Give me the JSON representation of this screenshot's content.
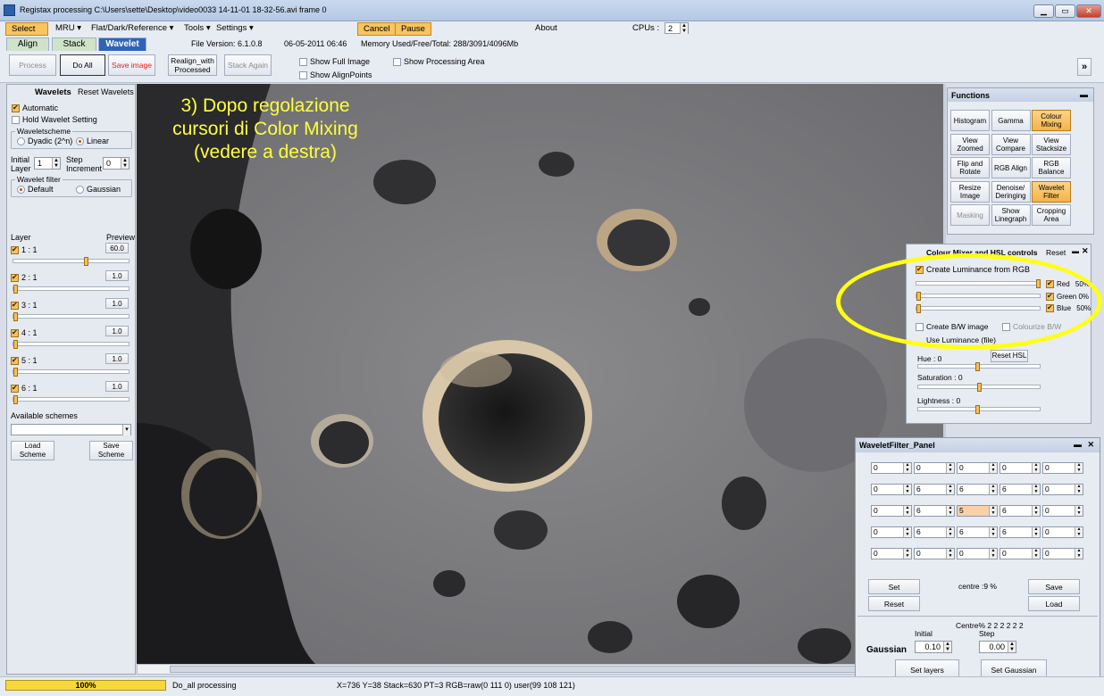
{
  "window": {
    "title": "Registax processing C:\\Users\\sette\\Desktop\\video0033 14-11-01 18-32-56.avi frame 0",
    "min": "▁",
    "max": "▭",
    "close": "✕"
  },
  "menu": {
    "select": "Select",
    "mru": "MRU ▾",
    "flat": "Flat/Dark/Reference ▾",
    "tools": "Tools ▾",
    "settings": "Settings ▾",
    "cancel": "Cancel",
    "pause": "Pause",
    "about": "About",
    "cpus_label": "CPUs :",
    "cpus_value": "2"
  },
  "tabs": {
    "align": "Align",
    "stack": "Stack",
    "wavelet": "Wavelet"
  },
  "info": {
    "version": "File Version: 6.1.0.8",
    "date": "06-05-2011 06:46",
    "memory": "Memory Used/Free/Total: 288/3091/4096Mb"
  },
  "toolbar": {
    "process": "Process",
    "do_all": "Do All",
    "save_image": "Save image",
    "realign": "Realign_with Processed",
    "stack_again": "Stack Again",
    "show_full": "Show Full Image",
    "show_align": "Show AlignPoints",
    "show_area": "Show Processing Area",
    "expand": "»"
  },
  "wavelets": {
    "title": "Wavelets",
    "reset": "Reset Wavelets",
    "automatic": "Automatic",
    "hold": "Hold Wavelet Setting",
    "scheme_label": "Waveletscheme",
    "dyadic": "Dyadic (2^n)",
    "linear": "Linear",
    "initial_label": "Initial Layer",
    "initial_value": "1",
    "step_label": "Step Increment",
    "step_value": "0",
    "filter_label": "Wavelet filter",
    "default": "Default",
    "gaussian": "Gaussian",
    "layer_header": "Layer",
    "preview_header": "Preview",
    "layers": [
      {
        "name": "1 : 1",
        "value": "60.0",
        "level": 0.6
      },
      {
        "name": "2 : 1",
        "value": "1.0",
        "level": 0.0
      },
      {
        "name": "3 : 1",
        "value": "1.0",
        "level": 0.0
      },
      {
        "name": "4 : 1",
        "value": "1.0",
        "level": 0.0
      },
      {
        "name": "5 : 1",
        "value": "1.0",
        "level": 0.0
      },
      {
        "name": "6 : 1",
        "value": "1.0",
        "level": 0.0
      }
    ],
    "schemes_label": "Available schemes",
    "load": "Load Scheme",
    "save": "Save Scheme"
  },
  "annotation": {
    "line1": "3) Dopo regolazione",
    "line2": "cursori di Color Mixing",
    "line3": "(vedere a destra)"
  },
  "functions": {
    "title": "Functions",
    "buttons": [
      "Histogram",
      "Gamma",
      "Colour Mixing",
      "View Zoomed",
      "View Compare",
      "View Stacksize",
      "Flip and Rotate",
      "RGB Align",
      "RGB Balance",
      "Resize Image",
      "Denoise/ Deringing",
      "Wavelet Filter",
      "Masking",
      "Show Linegraph",
      "Cropping Area"
    ]
  },
  "colour": {
    "title": "Colour Mixer and HSL controls",
    "reset": "Reset",
    "create_lum": "Create Luminance from RGB",
    "red": "Red",
    "red_pct": "50%",
    "green": "Green",
    "green_pct": "0%",
    "blue": "Blue",
    "blue_pct": "50%",
    "red_level": 1.0,
    "green_level": 0.0,
    "blue_level": 0.0,
    "create_bw": "Create B/W image",
    "colourize": "Colourize B/W",
    "use_lum": "Use Luminance (file)",
    "hue": "Hue : 0",
    "reset_hsl": "Reset HSL",
    "saturation": "Saturation : 0",
    "lightness": "Lightness : 0"
  },
  "wavfilter": {
    "title": "WaveletFilter_Panel",
    "grid": [
      [
        "0",
        "0",
        "0",
        "0",
        "0"
      ],
      [
        "0",
        "6",
        "6",
        "6",
        "0"
      ],
      [
        "0",
        "6",
        "5",
        "6",
        "0"
      ],
      [
        "0",
        "6",
        "6",
        "6",
        "0"
      ],
      [
        "0",
        "0",
        "0",
        "0",
        "0"
      ]
    ],
    "set": "Set",
    "reset": "Reset",
    "centre": "centre :9 %",
    "save": "Save",
    "load": "Load",
    "centre_pct": "Centre% 2 2 2 2 2 2",
    "initial": "Initial",
    "step": "Step",
    "gaussian": "Gaussian",
    "initial_value": "0.10",
    "step_value": "0.00",
    "set_layers": "Set layers",
    "set_gaussian": "Set Gaussian"
  },
  "status": {
    "progress": "100%",
    "task": "Do_all processing",
    "coords": "X=736 Y=38 Stack=630 PT=3 RGB=raw(0 111 0) user(99 108 121)"
  }
}
